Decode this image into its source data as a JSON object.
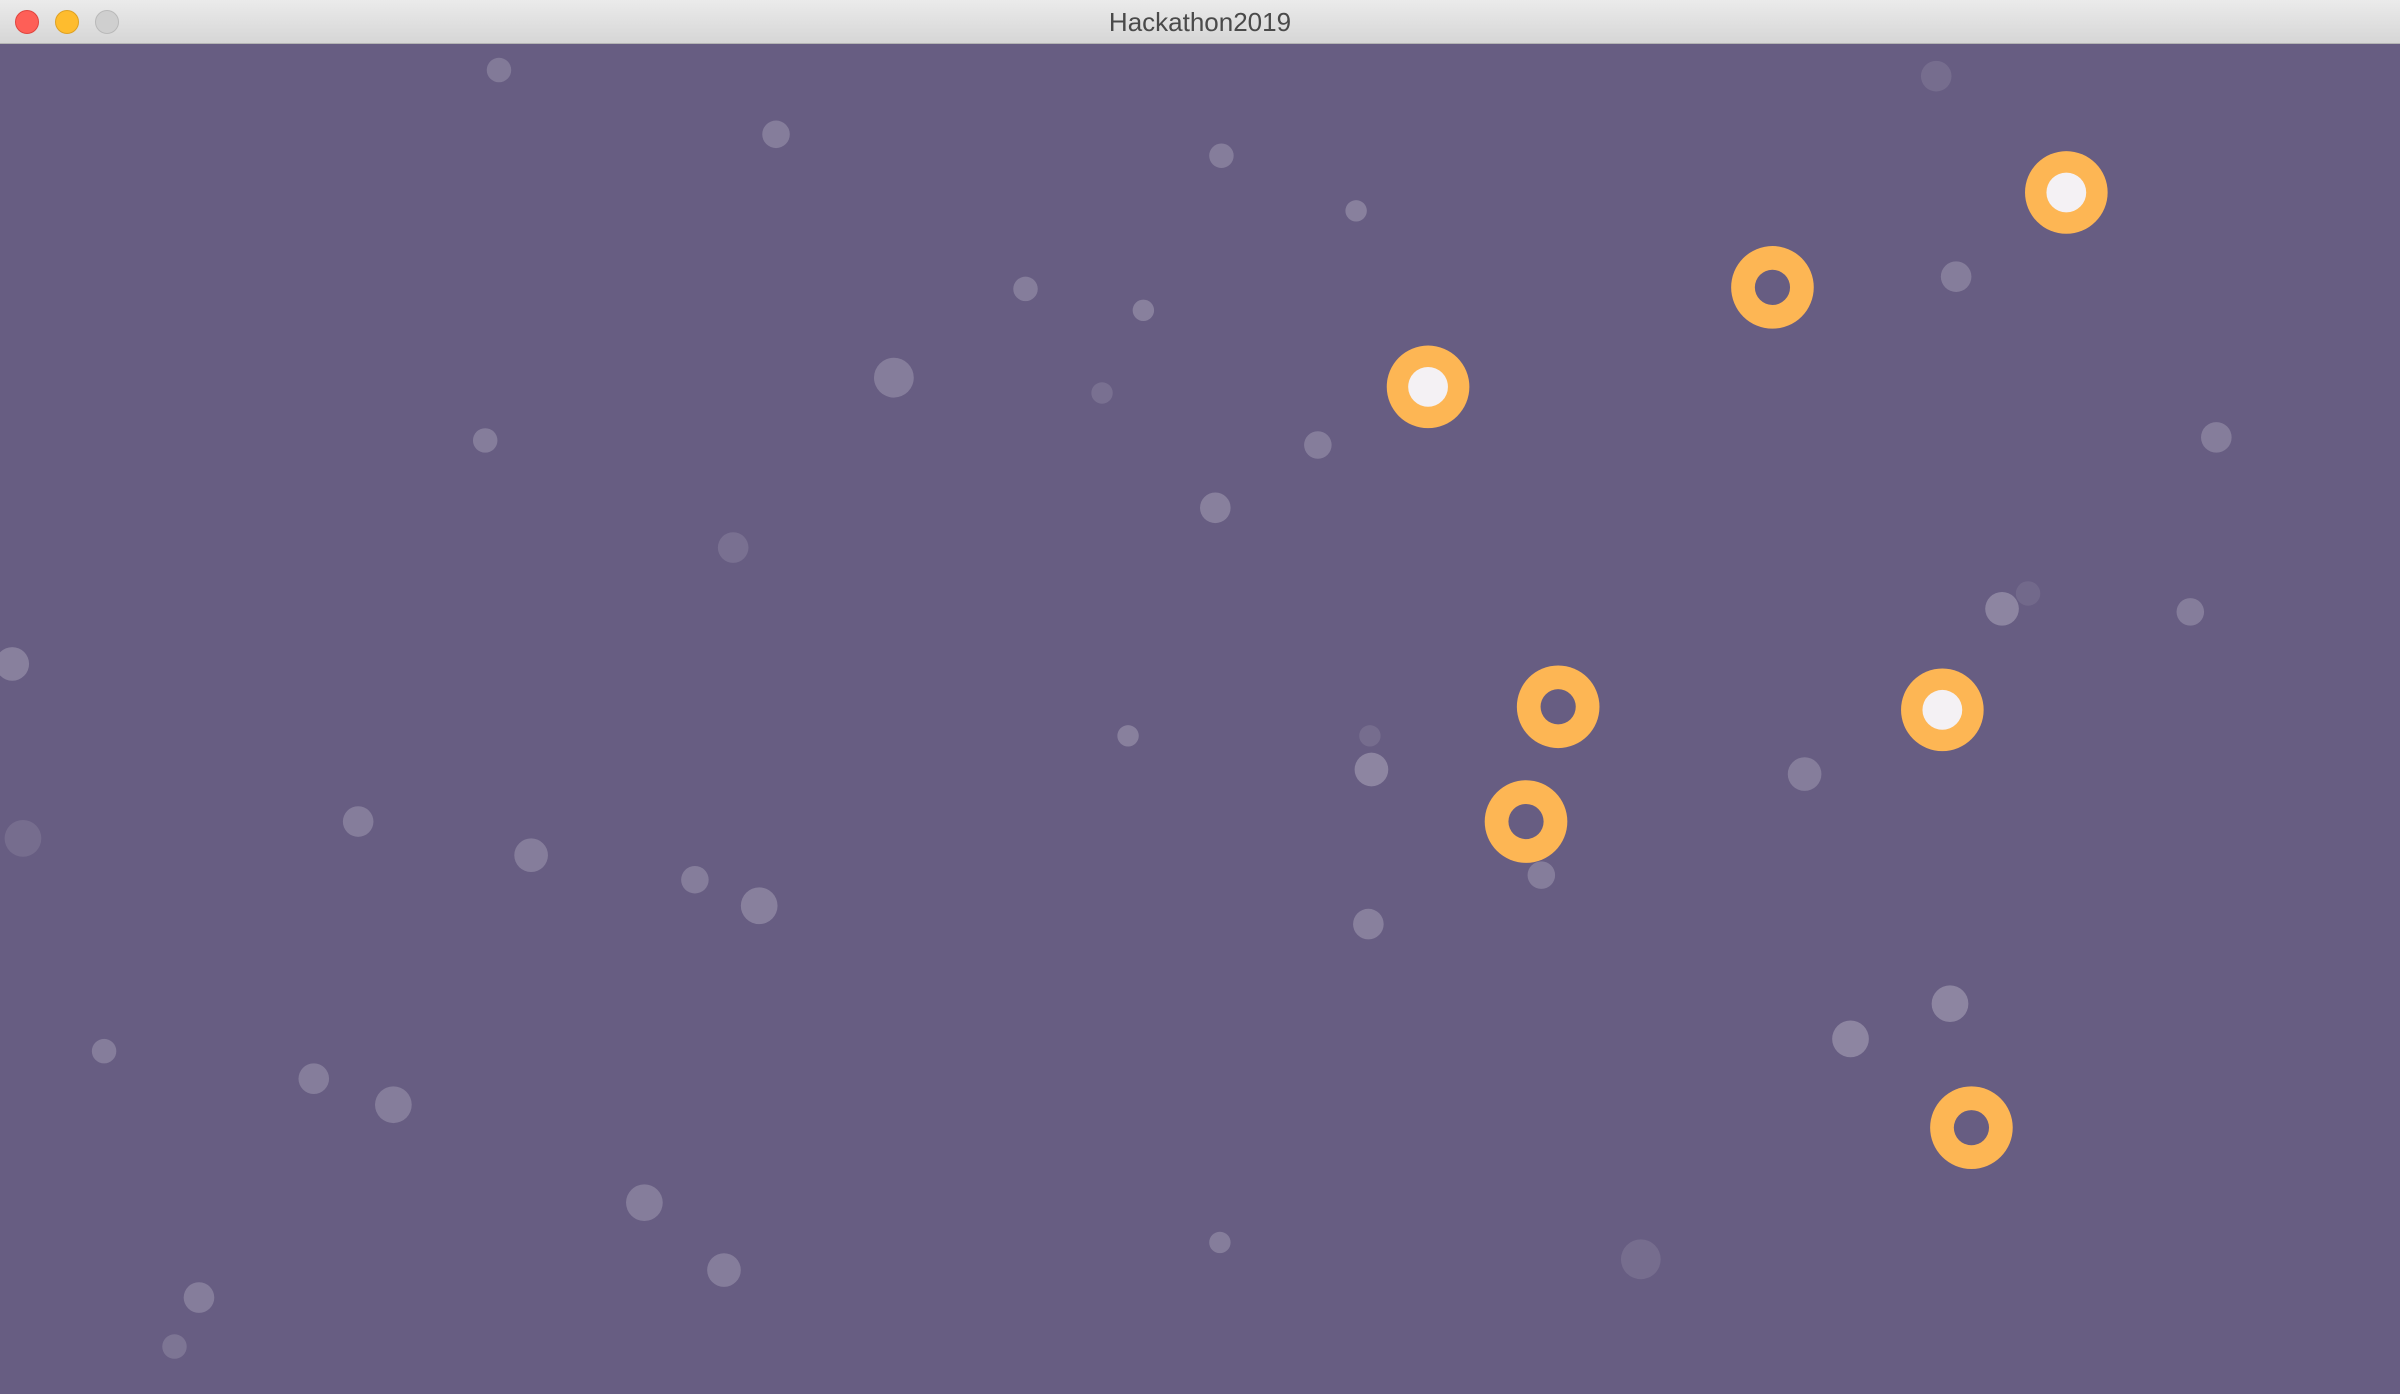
{
  "window": {
    "title": "Hackathon2019"
  },
  "colors": {
    "background": "#675d82",
    "ring": "#fdb654",
    "particle": "#ffffff",
    "ring_center_light": "#f4f1f4"
  },
  "scene": {
    "ring_count": 7,
    "lit_rings": 3,
    "dark_rings": 4
  }
}
